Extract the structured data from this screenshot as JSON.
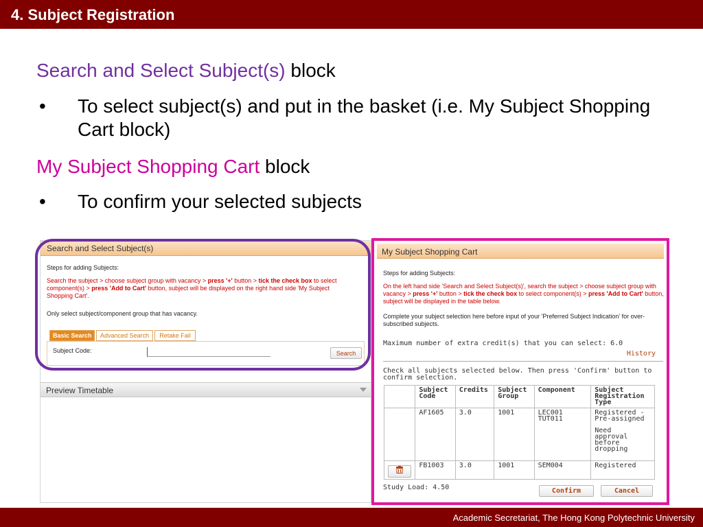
{
  "slide": {
    "title": "4. Subject Registration",
    "footer": "Academic Secretariat, The Hong Kong Polytechnic University",
    "heading1_colored": "Search and Select Subject(s)",
    "heading1_rest": " block",
    "bullet1": "To select subject(s) and put in the basket (i.e. My Subject Shopping Cart block)",
    "heading2_colored": "My Subject Shopping Cart",
    "heading2_rest": " block",
    "bullet2": "To confirm your selected subjects",
    "bullet_char": "•"
  },
  "search_panel": {
    "header": "Search and Select Subject(s)",
    "steps_heading": "Steps for adding Subjects:",
    "steps_1": "Search the subject > choose subject group with vacancy > ",
    "steps_2": "press '+'",
    "steps_3": " button > ",
    "steps_4": "tick the check box",
    "steps_5": " to select component(s) > ",
    "steps_6": "press 'Add to Cart'",
    "steps_7": " button, subject will be displayed on the right hand side 'My Subject Shopping Cart'.",
    "note": "Only select subject/component group that has vacancy.",
    "tabs": [
      "Basic Search",
      "Advanced Search",
      "Retake Fail"
    ],
    "subject_code_label": "Subject Code:",
    "subject_code_value": "",
    "search_button": "Search"
  },
  "preview": {
    "header": "Preview Timetable"
  },
  "cart": {
    "header": "My Subject Shopping Cart",
    "steps_heading": "Steps for adding Subjects:",
    "steps_1": "On the left hand side 'Search and Select Subject(s)', search the subject > choose subject group with vacancy > ",
    "steps_2": "press '+'",
    "steps_3": " button > ",
    "steps_4": "tick the check box",
    "steps_5": " to select component(s) > ",
    "steps_6": "press 'Add to Cart'",
    "steps_7": " button, subject will be displayed in the table below.",
    "note": "Complete your subject selection here before input of your 'Preferred Subject Indication' for over-subscribed subjects.",
    "max_credit": "Maximum number of extra credit(s) that you can select: 6.0",
    "history": "History",
    "confirm_instruction": "Check all subjects selected below. Then press 'Confirm' button to confirm selection.",
    "columns": [
      "",
      "Subject Code",
      "Credits",
      "Subject Group",
      "Component",
      "Subject Registration Type"
    ],
    "rows": [
      {
        "code": "AF1605",
        "credits": "3.0",
        "group": "1001",
        "component_1": "LEC001",
        "component_2": "TUT011",
        "type_1": "Registered -",
        "type_2": "Pre-assigned",
        "type_3": "Need",
        "type_4": "approval",
        "type_5": "before",
        "type_6": "dropping"
      },
      {
        "code": "FB1003",
        "credits": "3.0",
        "group": "1001",
        "component_1": "SEM004",
        "type_1": "Registered"
      }
    ],
    "study_load": "Study Load: 4.50",
    "confirm_button": "Confirm",
    "cancel_button": "Cancel"
  },
  "colors": {
    "brand_red": "#800000",
    "purple": "#7030a0",
    "magenta": "#cc0099",
    "orange_accent": "#e58a1e"
  }
}
